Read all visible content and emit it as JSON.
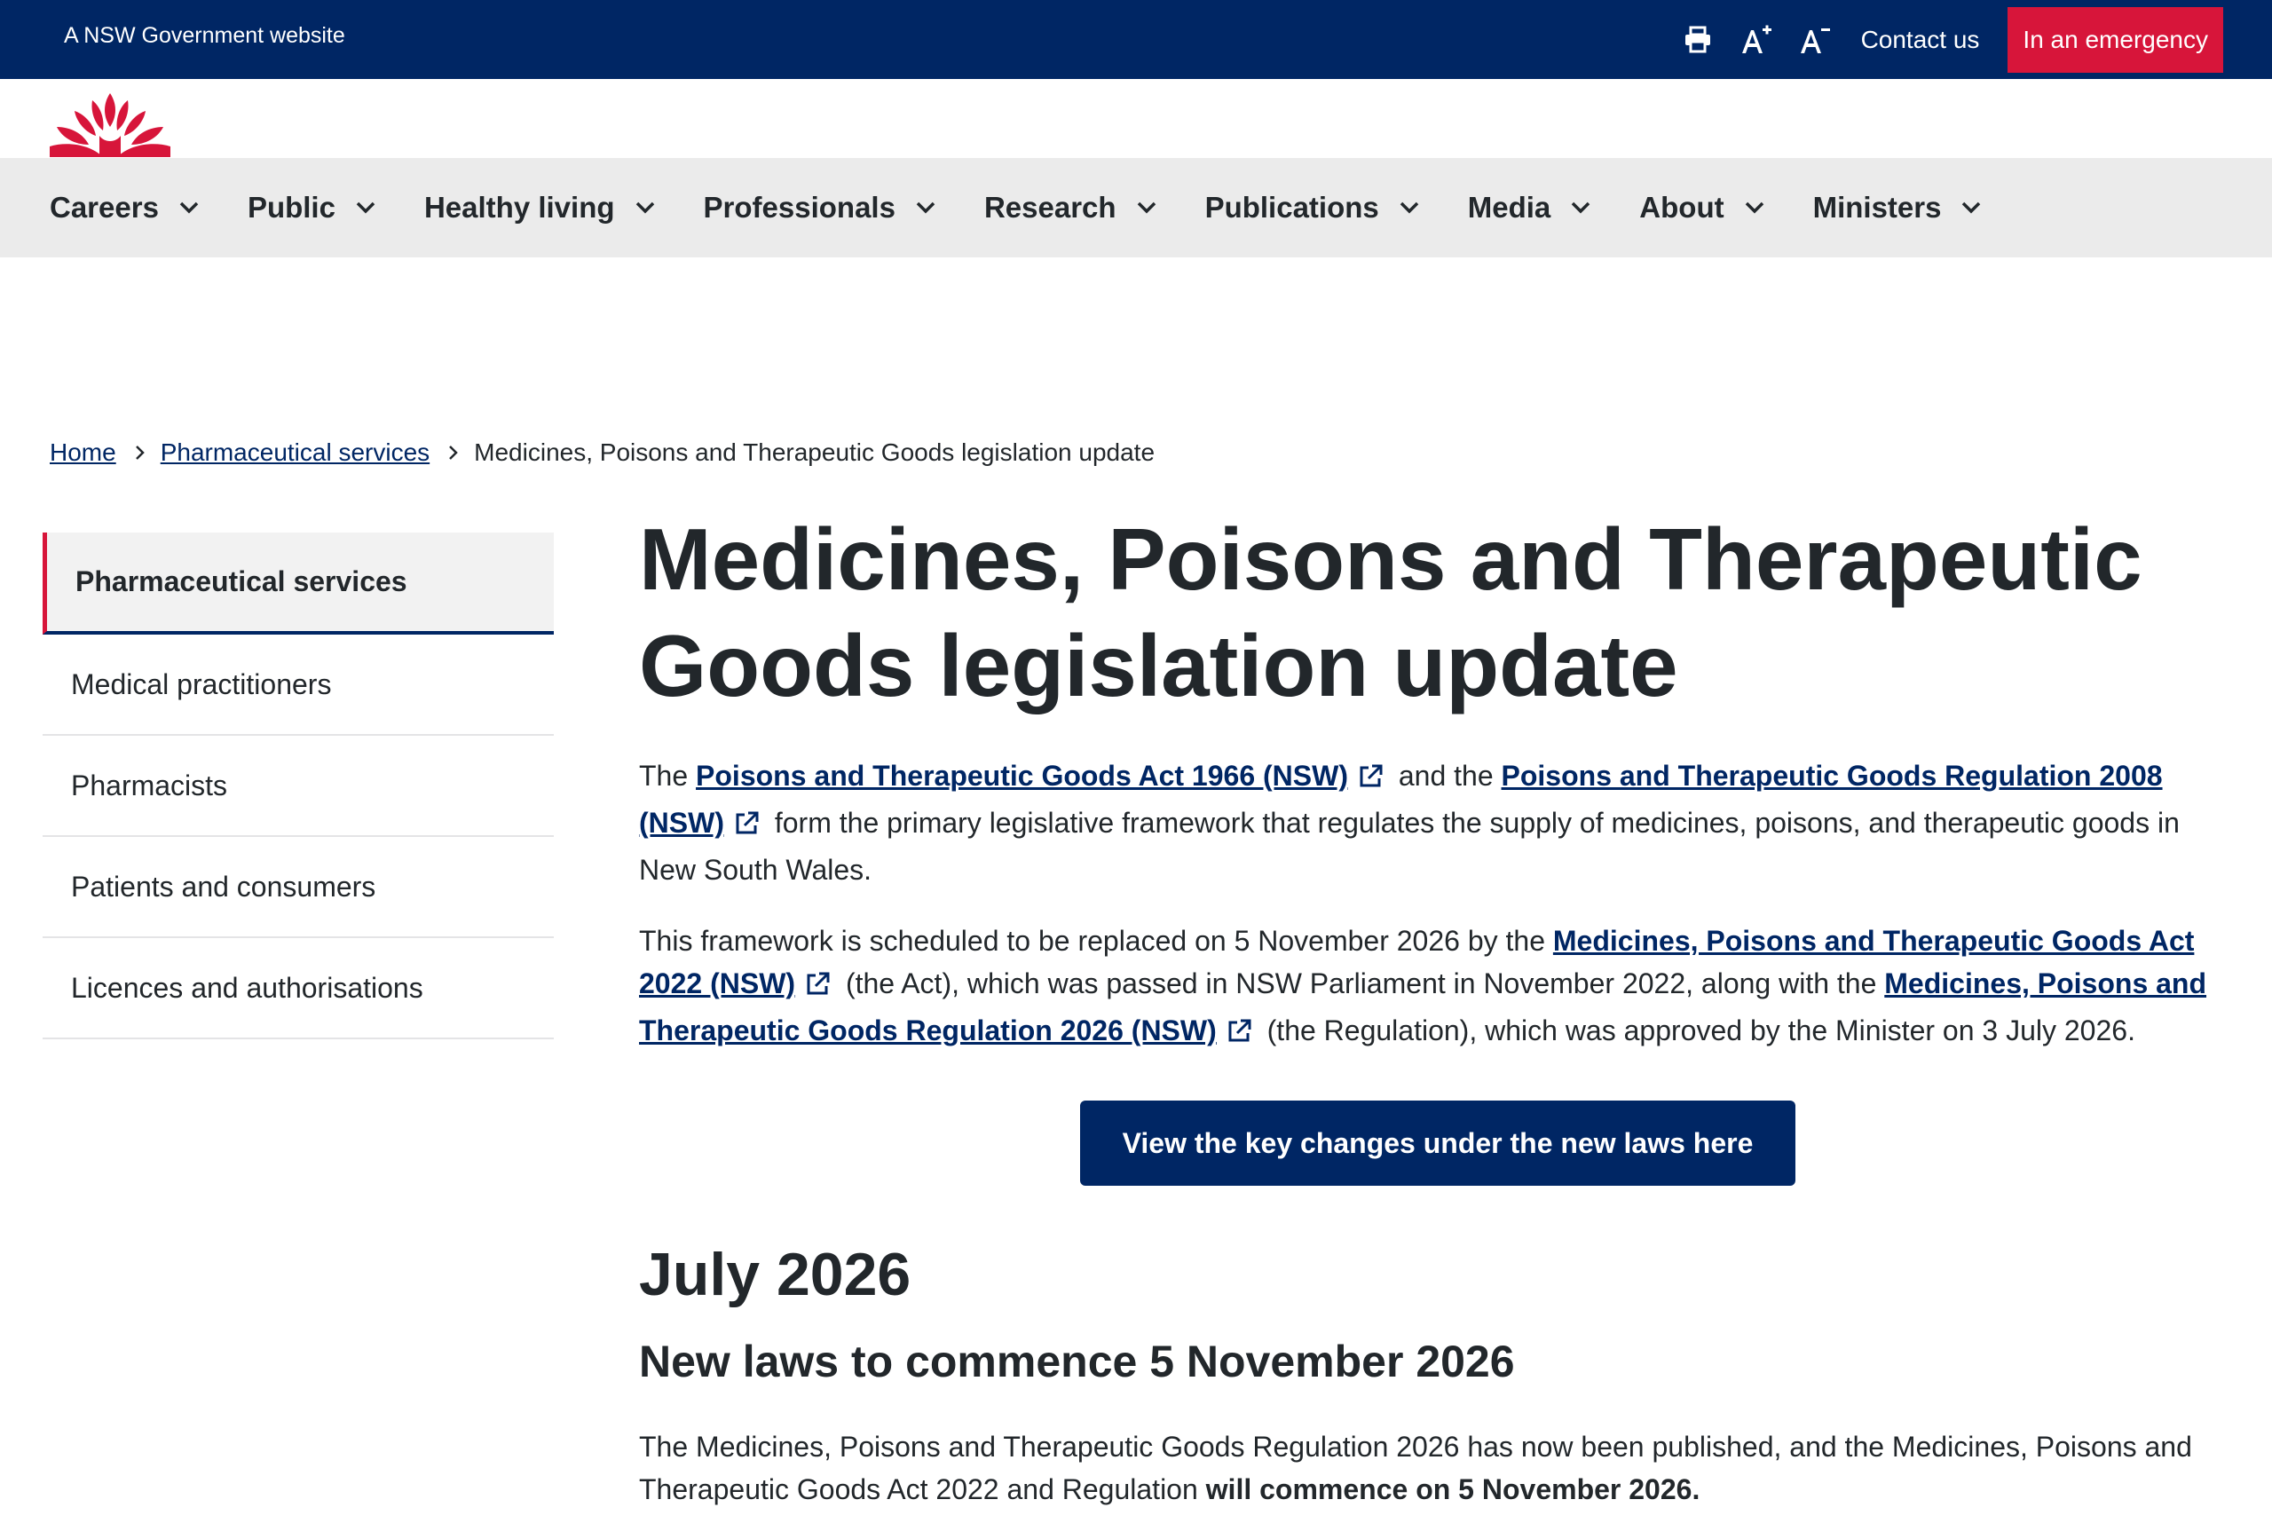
{
  "masthead": {
    "gov_label": "A NSW Government website",
    "contact_label": "Contact us",
    "emergency_label": "In an emergency",
    "icons": [
      "print-icon",
      "increase-text-icon",
      "decrease-text-icon"
    ]
  },
  "colors": {
    "navy": "#002664",
    "red": "#d7153a",
    "nav_bg": "#ebebeb",
    "text": "#22272b"
  },
  "nav": {
    "items": [
      "Careers",
      "Public",
      "Healthy living",
      "Professionals",
      "Research",
      "Publications",
      "Media",
      "About",
      "Ministers"
    ]
  },
  "breadcrumb": {
    "home": "Home",
    "parent": "Pharmaceutical services",
    "current": "Medicines, Poisons and Therapeutic Goods legislation update"
  },
  "sidenav": {
    "active": "Pharmaceutical services",
    "items": [
      "Medical practitioners",
      "Pharmacists",
      "Patients and consumers",
      "Licences and authorisations"
    ]
  },
  "content": {
    "title": "Medicines, Poisons and Therapeutic Goods legislation update",
    "p1": {
      "t1": "The ",
      "link1": "Poisons and Therapeutic Goods Act 1966 (NSW)",
      "t2": " and the ",
      "link2": "Poisons and Therapeutic Goods Regulation 2008 (NSW)",
      "t3": " form the primary legislative framework that regulates the supply of medicines, poisons, and therapeutic goods in New South Wales."
    },
    "p2": {
      "t1": "This framework is scheduled to be replaced on 5 November 2026 by the ",
      "link1": "Medicines, Poisons and Therapeutic Goods Act 2022 (NSW)",
      "t2": " (the Act), which was passed in NSW Parliament in November 2022, along with the ",
      "link2": "Medicines, Poisons and Therapeutic Goods Regulation 2026 (NSW)",
      "t3": " (the Regulation), which was approved by the Minister on 3 July 2026."
    },
    "cta_label": "View the key changes under the new laws here",
    "h2": "July 2026",
    "h3": "New laws to commence 5 November 2026",
    "p3": {
      "t1": "The Medicines, Poisons and Therapeutic Goods Regulation 2026 has now been published, and the Medicines, Poisons and Therapeutic Goods Act 2022 and Regulation ",
      "bold": "will commence on 5 November 2026."
    }
  }
}
